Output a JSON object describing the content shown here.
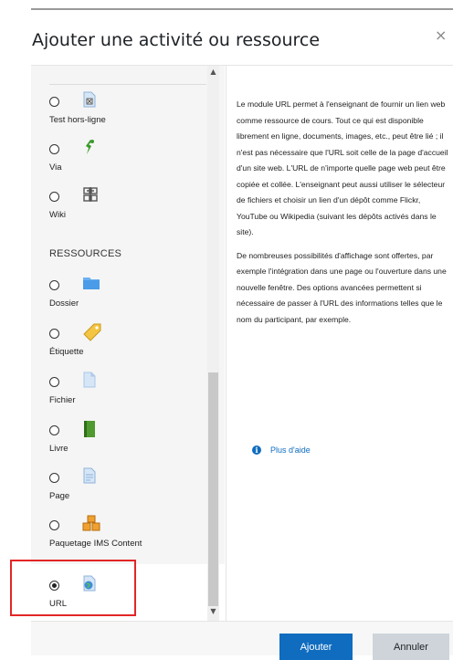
{
  "modal": {
    "title": "Ajouter une activité ou ressource",
    "close_glyph": "×"
  },
  "list": {
    "items": [
      {
        "label": "Test hors-ligne",
        "icon": "offline-quiz-icon",
        "selected": false
      },
      {
        "label": "Via",
        "icon": "via-icon",
        "selected": false
      },
      {
        "label": "Wiki",
        "icon": "wiki-icon",
        "selected": false
      }
    ],
    "section_heading": "RESSOURCES",
    "resources": [
      {
        "label": "Dossier",
        "icon": "folder-icon",
        "selected": false
      },
      {
        "label": "Étiquette",
        "icon": "label-tag-icon",
        "selected": false
      },
      {
        "label": "Fichier",
        "icon": "file-icon",
        "selected": false
      },
      {
        "label": "Livre",
        "icon": "book-icon",
        "selected": false
      },
      {
        "label": "Page",
        "icon": "page-icon",
        "selected": false
      },
      {
        "label": "Paquetage IMS Content",
        "icon": "ims-package-icon",
        "selected": false
      },
      {
        "label": "URL",
        "icon": "url-globe-icon",
        "selected": true
      }
    ]
  },
  "description": {
    "paragraph1": "Le module URL permet à l'enseignant de fournir un lien web comme ressource de cours. Tout ce qui est disponible librement en ligne, documents, images, etc., peut être lié ; il n'est pas nécessaire que l'URL soit celle de la page d'accueil d'un site web. L'URL de n'importe quelle page web peut être copiée et collée. L'enseignant peut aussi utiliser le sélecteur de fichiers et choisir un lien d'un dépôt comme Flickr, YouTube ou Wikipedia (suivant les dépôts activés dans le site).",
    "paragraph2": "De nombreuses possibilités d'affichage sont offertes, par exemple l'intégration dans une page ou l'ouverture dans une nouvelle fenêtre. Des options avancées permettent si nécessaire de passer à l'URL des informations telles que le nom du participant, par exemple.",
    "help_link": "Plus d'aide",
    "info_glyph": "i"
  },
  "footer": {
    "add_label": "Ajouter",
    "cancel_label": "Annuler"
  },
  "scroll": {
    "up_glyph": "▲",
    "down_glyph": "▼"
  },
  "colors": {
    "primary": "#0f6cbf",
    "highlight": "#e32626",
    "secondary_button": "#ced4da"
  }
}
